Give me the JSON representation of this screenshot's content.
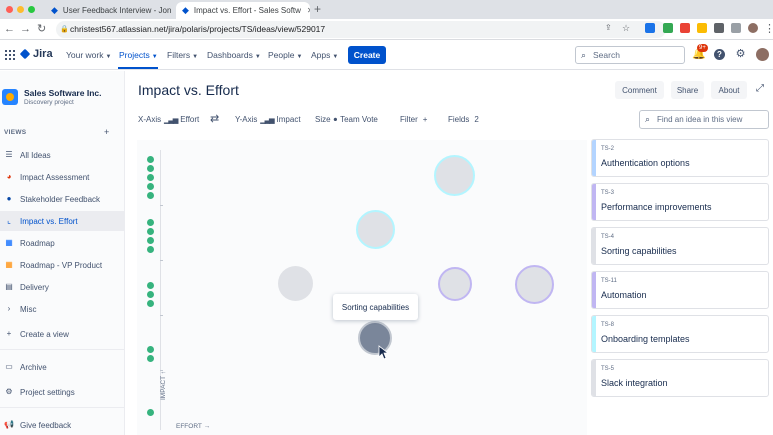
{
  "browser": {
    "tabs": [
      {
        "title": "User Feedback Interview - Jon",
        "active": false
      },
      {
        "title": "Impact vs. Effort - Sales Softw",
        "active": true
      }
    ],
    "url": "christest567.atlassian.net/jira/polaris/projects/TS/ideas/view/529017"
  },
  "topnav": {
    "logo": "Jira",
    "items": [
      "Your work",
      "Projects",
      "Filters",
      "Dashboards",
      "People",
      "Apps"
    ],
    "create_label": "Create",
    "search_placeholder": "Search",
    "notification_count": "9+"
  },
  "sidebar": {
    "project_name": "Sales Software Inc.",
    "project_type": "Discovery project",
    "views_label": "VIEWS",
    "views": [
      {
        "label": "All Ideas",
        "icon": "list-icon"
      },
      {
        "label": "Impact Assessment",
        "icon": "impact-icon"
      },
      {
        "label": "Stakeholder Feedback",
        "icon": "stakeholder-icon"
      },
      {
        "label": "Impact vs. Effort",
        "icon": "matrix-icon",
        "active": true
      },
      {
        "label": "Roadmap",
        "icon": "roadmap-icon"
      },
      {
        "label": "Roadmap - VP Product",
        "icon": "roadmap-vp-icon"
      },
      {
        "label": "Delivery",
        "icon": "delivery-icon"
      },
      {
        "label": "Misc",
        "icon": "chevron-right-icon"
      },
      {
        "label": "Create a view",
        "icon": "plus-icon"
      }
    ],
    "archive_label": "Archive",
    "settings_label": "Project settings",
    "feedback_label": "Give feedback"
  },
  "header": {
    "title": "Impact vs. Effort",
    "comment_label": "Comment",
    "share_label": "Share",
    "about_label": "About"
  },
  "toolbar": {
    "x_axis_label": "X-Axis",
    "x_axis_value": "Effort",
    "y_axis_label": "Y-Axis",
    "y_axis_value": "Impact",
    "size_label": "Size",
    "size_value": "Team Vote",
    "filter_label": "Filter",
    "fields_label": "Fields",
    "fields_count": "2",
    "find_placeholder": "Find an idea in this view"
  },
  "chart": {
    "y_axis_title": "IMPACT",
    "x_axis_title": "EFFORT",
    "tooltip": "Sorting capabilities"
  },
  "ideas": [
    {
      "key": "TS-2",
      "summary": "Authentication options",
      "stripe": "#b3d4ff"
    },
    {
      "key": "TS-3",
      "summary": "Performance improvements",
      "stripe": "#c0b6f2"
    },
    {
      "key": "TS-4",
      "summary": "Sorting capabilities",
      "stripe": "#dfe1e6"
    },
    {
      "key": "TS-11",
      "summary": "Automation",
      "stripe": "#c0b6f2"
    },
    {
      "key": "TS-8",
      "summary": "Onboarding templates",
      "stripe": "#b3f5ff"
    },
    {
      "key": "TS-5",
      "summary": "Slack integration",
      "stripe": "#dfe1e6"
    }
  ],
  "colors": {
    "accent": "#0052cc",
    "dot_green": "#36b37e"
  }
}
